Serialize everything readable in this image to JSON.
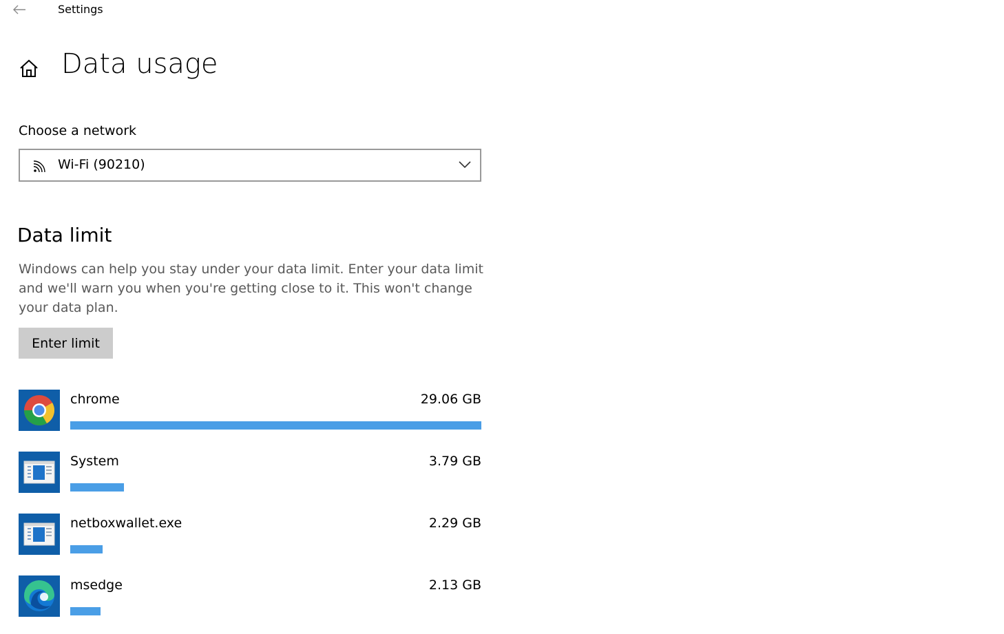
{
  "window": {
    "title": "Settings"
  },
  "page": {
    "title": "Data usage"
  },
  "network": {
    "label": "Choose a network",
    "selected": "Wi-Fi (90210)"
  },
  "data_limit": {
    "title": "Data limit",
    "description": "Windows can help you stay under your data limit. Enter your data limit and we'll warn you when you're getting close to it. This won't change your data plan.",
    "button_label": "Enter limit"
  },
  "apps": [
    {
      "name": "chrome",
      "usage": "29.06 GB",
      "gb": 29.06,
      "icon": "chrome-icon"
    },
    {
      "name": "System",
      "usage": "3.79 GB",
      "gb": 3.79,
      "icon": "system-window-icon"
    },
    {
      "name": "netboxwallet.exe",
      "usage": "2.29 GB",
      "gb": 2.29,
      "icon": "system-window-icon"
    },
    {
      "name": "msedge",
      "usage": "2.13 GB",
      "gb": 2.13,
      "icon": "edge-icon"
    }
  ],
  "colors": {
    "accent_bar": "#4a9ee6",
    "icon_tile": "#0f5ea8",
    "button_bg": "#cccccc",
    "border": "#999999"
  }
}
